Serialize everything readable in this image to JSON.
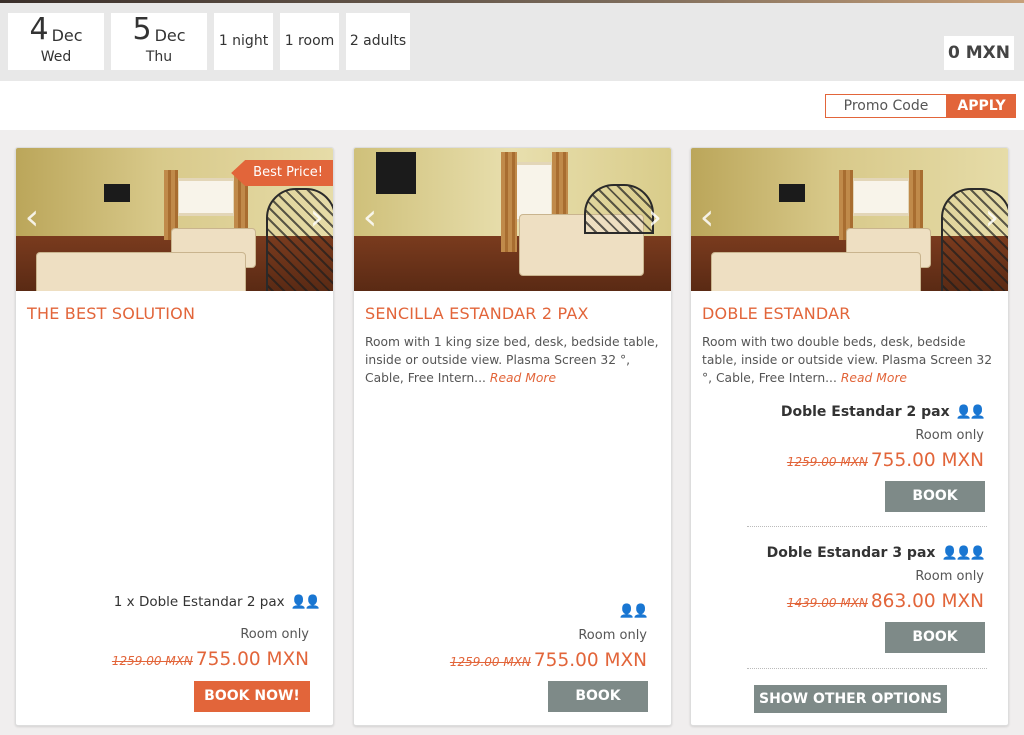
{
  "search": {
    "checkin": {
      "day": "4",
      "month": "Dec",
      "weekday": "Wed"
    },
    "checkout": {
      "day": "5",
      "month": "Dec",
      "weekday": "Thu"
    },
    "nights": "1 night",
    "rooms": "1 room",
    "guests": "2 adults",
    "total": "0 MXN"
  },
  "promo": {
    "placeholder": "Promo Code",
    "apply_label": "APPLY"
  },
  "colors": {
    "accent": "#e2653a",
    "button_grey": "#7e8a88"
  },
  "cards": [
    {
      "ribbon": "Best Price!",
      "title": "THE BEST SOLUTION",
      "room_line": "1 x Doble Estandar 2 pax",
      "occupancy_icon": "two-people-icon",
      "board": "Room only",
      "old_price": "1259.00 MXN",
      "price": "755.00 MXN",
      "button": "BOOK NOW!"
    },
    {
      "title": "SENCILLA ESTANDAR 2 PAX",
      "description": "Room with 1 king size bed, desk, bedside table, inside or outside view. Plasma Screen 32 °, Cable, Free Intern...",
      "read_more": "Read More",
      "occupancy_icon": "two-people-icon",
      "board": "Room only",
      "old_price": "1259.00 MXN",
      "price": "755.00 MXN",
      "button": "BOOK"
    },
    {
      "title": "DOBLE ESTANDAR",
      "description": "Room with two double beds, desk, bedside table, inside or outside view. Plasma Screen 32 °, Cable, Free Intern...",
      "read_more": "Read More",
      "options": [
        {
          "name": "Doble Estandar 2 pax",
          "occupancy_icon": "two-people-icon",
          "board": "Room only",
          "old_price": "1259.00 MXN",
          "price": "755.00 MXN",
          "button": "BOOK"
        },
        {
          "name": "Doble Estandar 3 pax",
          "occupancy_icon": "three-people-icon",
          "board": "Room only",
          "old_price": "1439.00 MXN",
          "price": "863.00 MXN",
          "button": "BOOK"
        }
      ],
      "show_options": "SHOW OTHER OPTIONS"
    }
  ]
}
